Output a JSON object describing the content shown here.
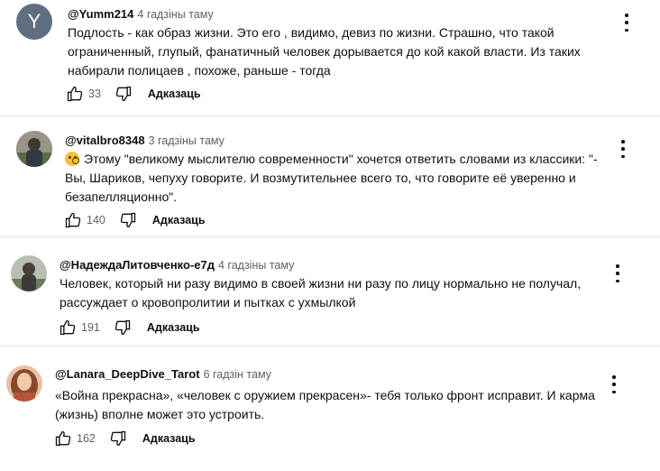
{
  "comments": [
    {
      "author": "@Yumm214",
      "time": "4 гадзіны таму",
      "avatar_letter": "Y",
      "avatar_color": "#5f6f7f",
      "lines": [
        "Подлость  - как образ жизни. Это его , видимо, девиз по жизни. Страшно, что такой",
        "ограниченный, глупый, фанатичный человек дорывается до кой какой власти. Из таких",
        "набирали полицаев , похоже, раньше - тогда"
      ],
      "likes": "33",
      "reply_label": "Адказаць"
    },
    {
      "author": "@vitalbro8348",
      "time": "3 гадзіны таму",
      "lines": [
        "Этому \"великому мыслителю современности\" хочется ответить словами из классики:  \"-",
        "Вы, Шариков, чепуху говорите. И возмутительнее всего то, что говорите её уверенно и",
        "безапелляционно\"."
      ],
      "emoji": "face-with-monocle-icon",
      "likes": "140",
      "reply_label": "Адказаць"
    },
    {
      "author": "@НадеждаЛитовченко-е7д",
      "time": "4 гадзіны таму",
      "lines": [
        "Человек, который ни разу видимо в своей жизни ни разу по лицу нормально не получал,",
        "рассуждает о кровопролитии и пытках с ухмылкой"
      ],
      "likes": "191",
      "reply_label": "Адказаць"
    },
    {
      "author": "@Lanara_DeepDive_Tarot",
      "time": "6 гадзін таму",
      "lines": [
        "«Война прекрасна», «человек с оружием прекрасен»- тебя только фронт исправит. И карма",
        "(жизнь) вполне может это устроить."
      ],
      "likes": "162",
      "reply_label": "Адказаць"
    }
  ],
  "icons": {
    "like": "thumbs-up-icon",
    "dislike": "thumbs-down-icon",
    "menu": "more-vertical-icon"
  }
}
